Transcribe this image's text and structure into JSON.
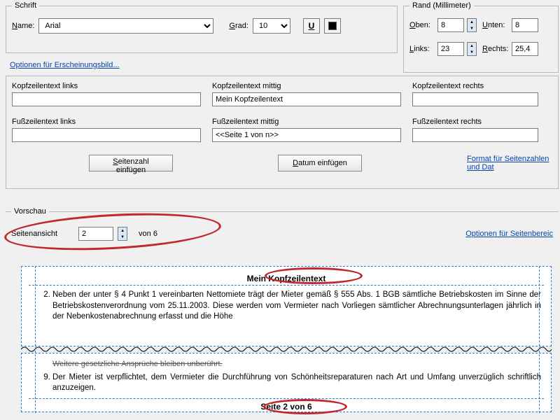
{
  "font": {
    "group": "Schrift",
    "name_label": "Name:",
    "name_value": "Arial",
    "size_label": "Grad:",
    "size_value": "10",
    "underline_tip": "U",
    "appearance_link": "Optionen für Erscheinungsbild..."
  },
  "margin": {
    "group": "Rand (Millimeter)",
    "top_label": "Oben:",
    "top_value": "8",
    "bottom_label": "Unten:",
    "bottom_value": "8",
    "left_label": "Links:",
    "left_value": "23",
    "right_label": "Rechts:",
    "right_value": "25,4"
  },
  "hf": {
    "header_left_label": "Kopfzeilentext links",
    "header_left_value": "",
    "header_center_label": "Kopfzeilentext mittig",
    "header_center_value": "Mein Kopfzeilentext",
    "header_right_label": "Kopfzeilentext rechts",
    "header_right_value": "",
    "footer_left_label": "Fußzeilentext links",
    "footer_left_value": "",
    "footer_center_label": "Fußzeilentext mittig",
    "footer_center_value": "<<Seite 1 von n>>",
    "footer_right_label": "Fußzeilentext rechts",
    "footer_right_value": "",
    "insert_page_btn": "Seitenzahl einfügen",
    "insert_date_btn": "Datum einfügen",
    "page_format_link": "Format für Seitenzahlen und Dat"
  },
  "preview": {
    "group": "Vorschau",
    "page_view_label": "Seitenansicht",
    "page_value": "2",
    "page_of": "von 6",
    "page_range_link": "Optionen für Seitenbereic",
    "header_text": "Mein Kopfzeilentext",
    "para2": "Neben der unter § 4 Punkt 1 vereinbarten Nettomiete trägt der Mieter gemäß § 555 Abs. 1 BGB sämtliche Betriebskosten im Sinne der Betriebskostenverordnung vom 25.11.2003. Diese werden vom Vermieter nach Vorliegen sämtlicher Abrechnungsunterlagen jährlich in der Nebenkostenabrechnung erfasst und die Höhe",
    "para8tail": "Weitere gesetzliche Ansprüche bleiben unberührt.",
    "para9": "Der Mieter ist verpflichtet, dem Vermieter die Durchführung von Schönheitsreparaturen nach Art und Umfang unverzüglich schriftlich anzuzeigen.",
    "footer_text": "Seite 2 von 6"
  }
}
